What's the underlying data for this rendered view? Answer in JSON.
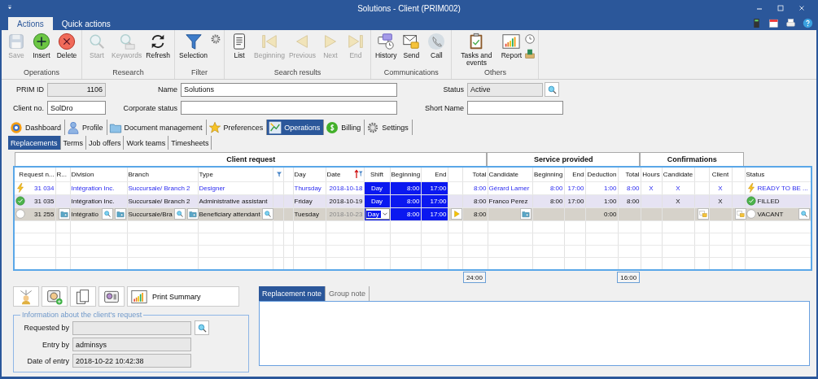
{
  "window": {
    "title": "Solutions - Client (PRIM002)"
  },
  "ribbon_tabs": [
    {
      "label": "Actions",
      "selected": true
    },
    {
      "label": "Quick actions",
      "selected": false
    }
  ],
  "ribbon_groups": [
    {
      "label": "Operations",
      "buttons": [
        {
          "kind": "save",
          "label": "Save",
          "disabled": true
        },
        {
          "kind": "insert",
          "label": "Insert",
          "disabled": false
        },
        {
          "kind": "delete",
          "label": "Delete",
          "disabled": false
        }
      ]
    },
    {
      "label": "Research",
      "buttons": [
        {
          "kind": "start",
          "label": "Start",
          "disabled": true
        },
        {
          "kind": "keywords",
          "label": "Keywords",
          "disabled": true
        },
        {
          "kind": "refresh",
          "label": "Refresh",
          "disabled": false
        }
      ]
    },
    {
      "label": "Filter",
      "buttons": [
        {
          "kind": "selection",
          "label": "Selection",
          "disabled": false
        }
      ],
      "side": [
        {
          "kind": "gear"
        }
      ]
    },
    {
      "label": "Search results",
      "buttons": [
        {
          "kind": "list",
          "label": "List",
          "disabled": false
        },
        {
          "kind": "beginning",
          "label": "Beginning",
          "disabled": true
        },
        {
          "kind": "previous",
          "label": "Previous",
          "disabled": true
        },
        {
          "kind": "next",
          "label": "Next",
          "disabled": true
        },
        {
          "kind": "end",
          "label": "End",
          "disabled": true
        }
      ]
    },
    {
      "label": "Communications",
      "buttons": [
        {
          "kind": "history",
          "label": "History",
          "disabled": false
        },
        {
          "kind": "send",
          "label": "Send",
          "disabled": false
        },
        {
          "kind": "call",
          "label": "Call",
          "disabled": false
        }
      ]
    },
    {
      "label": "Others",
      "buttons": [
        {
          "kind": "tasks",
          "label": "Tasks and events",
          "disabled": false
        },
        {
          "kind": "report",
          "label": "Report",
          "disabled": false
        }
      ],
      "side": [
        {
          "kind": "clock"
        },
        {
          "kind": "excel"
        }
      ]
    }
  ],
  "form": {
    "fields": [
      {
        "label": "PRIM ID",
        "value": "1106",
        "kind": "number",
        "readonly": true,
        "lookup": false
      },
      {
        "label": "Name",
        "value": "Solutions",
        "kind": "text",
        "readonly": false,
        "lookup": false
      },
      {
        "label": "Status",
        "value": "Active",
        "kind": "text",
        "readonly": true,
        "lookup": true
      },
      {
        "label": "Client no.",
        "value": "SolDro",
        "kind": "text",
        "readonly": false,
        "lookup": false
      },
      {
        "label": "Corporate status",
        "kind": "text",
        "readonly": false,
        "lookup": false
      },
      {
        "label": "Short Name",
        "kind": "text",
        "readonly": false,
        "lookup": false
      }
    ]
  },
  "main_tabs": [
    {
      "label": "Dashboard",
      "kind": "dashboard",
      "selected": false
    },
    {
      "label": "Profile",
      "kind": "profile",
      "selected": false
    },
    {
      "label": "Document management",
      "kind": "document",
      "selected": false
    },
    {
      "label": "Preferences",
      "kind": "star",
      "selected": false
    },
    {
      "label": "Operations",
      "kind": "operations",
      "selected": true
    },
    {
      "label": "Billing",
      "kind": "billing",
      "selected": false
    },
    {
      "label": "Settings",
      "kind": "gear",
      "selected": false
    }
  ],
  "sub_tabs": [
    {
      "label": "Replacements",
      "selected": true
    },
    {
      "label": "Terms",
      "selected": false
    },
    {
      "label": "Job offers",
      "selected": false
    },
    {
      "label": "Work teams",
      "selected": false
    },
    {
      "label": "Timesheets",
      "selected": false
    }
  ],
  "table": {
    "groups": [
      {
        "label": "Client request",
        "columns": [
          {
            "label": "Request n...",
            "kind": "number"
          },
          {
            "label": "R...",
            "kind": "folder"
          },
          {
            "label": "Division",
            "kind": "lookup_folder"
          },
          {
            "label": "Branch",
            "kind": "lookup_folder"
          },
          {
            "label": "Type",
            "kind": "lookup"
          },
          {
            "kind": "text",
            "filter": true
          },
          {
            "kind": "text"
          },
          {
            "label": "Day",
            "kind": "text"
          },
          {
            "label": "Date",
            "kind": "number",
            "sort": true,
            "filter": true
          },
          {
            "label": "Shift",
            "kind": "dropdown",
            "highlight": true
          },
          {
            "label": "Beginning",
            "kind": "number",
            "highlight": true
          },
          {
            "label": "End",
            "kind": "number",
            "highlight": true
          },
          {
            "kind": "play"
          },
          {
            "label": "Total",
            "kind": "number",
            "total": "24:00"
          }
        ]
      },
      {
        "label": "Service provided",
        "columns": [
          {
            "label": "Candidate",
            "kind": "folder"
          },
          {
            "label": "Beginning",
            "kind": "number"
          },
          {
            "label": "End",
            "kind": "number"
          },
          {
            "label": "Deduction",
            "kind": "number"
          },
          {
            "label": "Total",
            "kind": "number",
            "total": "16:00"
          }
        ]
      },
      {
        "label": "Confirmations",
        "columns": [
          {
            "label": "Hours",
            "kind": "center"
          },
          {
            "label": "Candidate",
            "kind": "center"
          },
          {
            "kind": "mail"
          },
          {
            "label": "Client",
            "kind": "center"
          },
          {
            "kind": "mail"
          }
        ]
      },
      {
        "columns": [
          {
            "label": "Status",
            "kind": "lookup"
          }
        ]
      }
    ],
    "rows": [
      {
        "kind": "ready",
        "selected": false,
        "editing": false,
        "cells": [
          "31 034",
          null,
          "Intégration Inc.",
          "Succursale/ Branch 2",
          "Designer",
          null,
          null,
          "Thursday",
          "2018-10-18",
          "Day",
          "8:00",
          "17:00",
          null,
          "8:00",
          "Gérard Lamer",
          "8:00",
          "17:00",
          "1:00",
          "8:00",
          "X",
          "X",
          null,
          "X",
          null,
          "READY TO BE ..."
        ]
      },
      {
        "kind": "filled",
        "selected": true,
        "editing": false,
        "cells": [
          "31 035",
          null,
          "Intégration Inc.",
          "Succursale/ Branch 2",
          "Administrative assistant",
          null,
          null,
          "Friday",
          "2018-10-19",
          "Day",
          "8:00",
          "17:00",
          null,
          "8:00",
          "Franco Perez",
          "8:00",
          "17:00",
          "1:00",
          "8:00",
          null,
          "X",
          null,
          "X",
          null,
          "FILLED"
        ]
      },
      {
        "kind": "vacant",
        "selected": false,
        "editing": true,
        "cells": [
          "31 255",
          null,
          "Intégratio",
          "Succursale/Bra",
          "Beneficiary attendant",
          null,
          null,
          "Tuesday",
          "2018-10-23",
          "Day",
          "8:00",
          "17:00",
          null,
          "8:00",
          null,
          null,
          null,
          "0:00",
          null,
          null,
          null,
          null,
          null,
          null,
          "VACANT"
        ]
      }
    ]
  },
  "bottom_buttons": [
    {
      "kind": "hierarchy"
    },
    {
      "kind": "add_person"
    },
    {
      "kind": "copy"
    },
    {
      "kind": "id_card"
    },
    {
      "kind": "report",
      "label": "Print Summary"
    }
  ],
  "request_info": {
    "title": "Information about the client's request",
    "fields": [
      {
        "label": "Requested by",
        "readonly": true,
        "lookup": true
      },
      {
        "label": "Entry by",
        "value": "adminsys",
        "readonly": true,
        "lookup": false
      },
      {
        "label": "Date of entry",
        "value": "2018-10-22 10:42:38",
        "readonly": true,
        "lookup": false
      }
    ]
  },
  "note_tabs": [
    {
      "label": "Replacement note",
      "selected": true
    },
    {
      "label": "Group note",
      "selected": false
    }
  ]
}
